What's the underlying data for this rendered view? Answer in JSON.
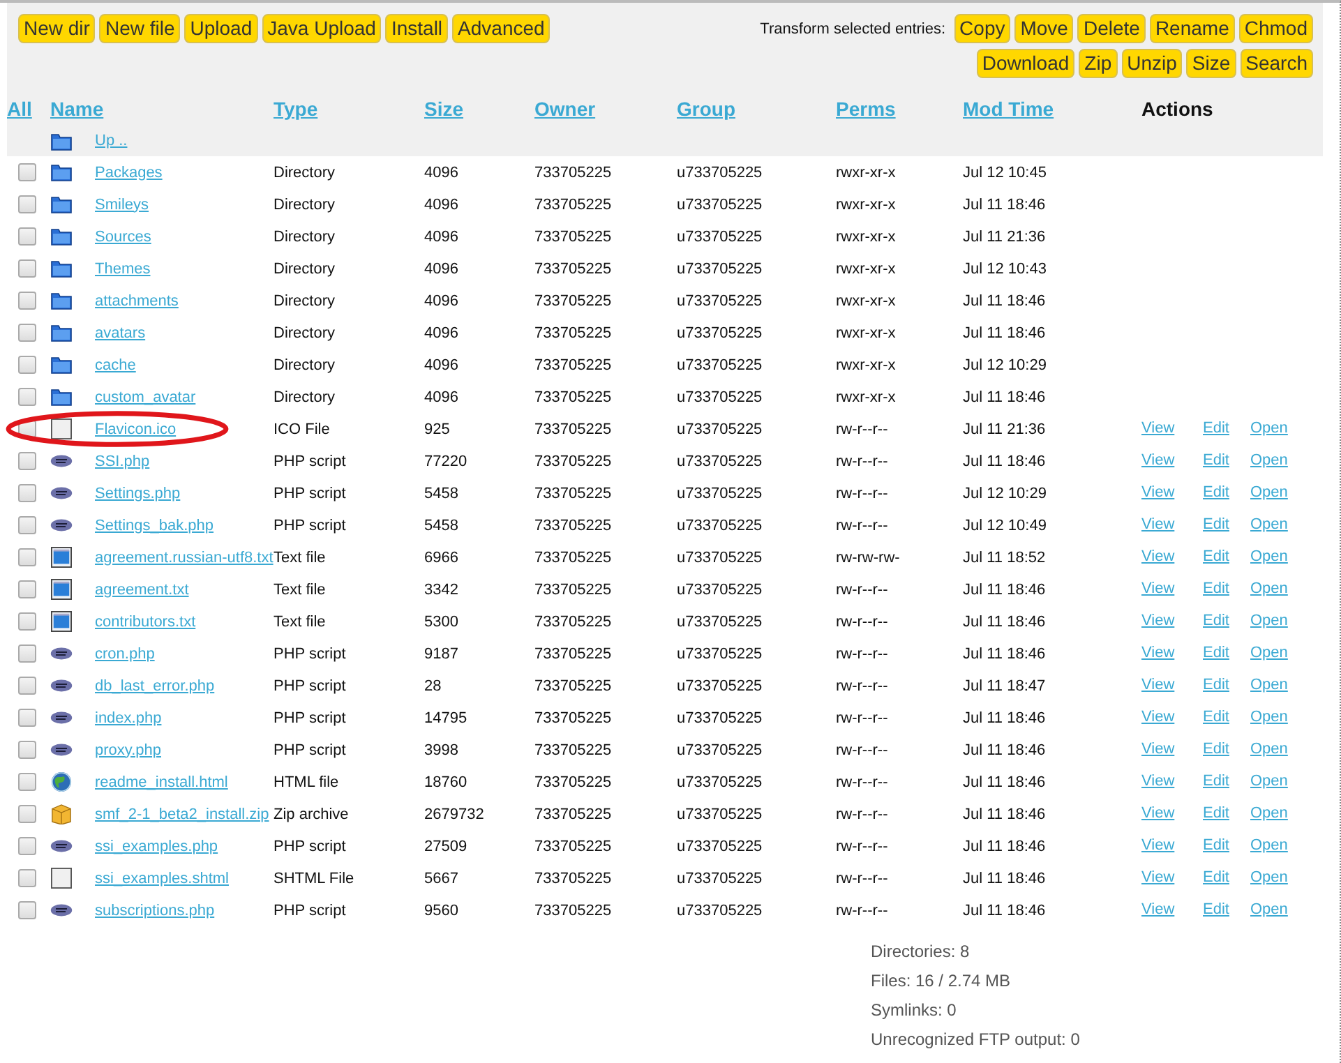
{
  "toolbar": {
    "buttons": [
      "New dir",
      "New file",
      "Upload",
      "Java Upload",
      "Install",
      "Advanced"
    ],
    "transform_label": "Transform selected entries:",
    "transform_buttons": [
      [
        "Copy",
        "Move",
        "Delete",
        "Rename",
        "Chmod"
      ],
      [
        "Download",
        "Zip",
        "Unzip",
        "Size",
        "Search"
      ]
    ]
  },
  "table": {
    "select_all": "All",
    "columns": [
      "Name",
      "Type",
      "Size",
      "Owner",
      "Group",
      "Perms",
      "Mod Time"
    ],
    "actions_heading": "Actions",
    "up": {
      "kind": "folder",
      "name": "Up .."
    },
    "rows": [
      {
        "kind": "folder",
        "checked": false,
        "circled": false,
        "name": "Packages",
        "type": "Directory",
        "size": "4096",
        "owner": "733705225",
        "group": "u733705225",
        "perms": "rwxr-xr-x",
        "time": "Jul 12 10:45",
        "actions": []
      },
      {
        "kind": "folder",
        "checked": false,
        "circled": false,
        "name": "Smileys",
        "type": "Directory",
        "size": "4096",
        "owner": "733705225",
        "group": "u733705225",
        "perms": "rwxr-xr-x",
        "time": "Jul 11 18:46",
        "actions": []
      },
      {
        "kind": "folder",
        "checked": false,
        "circled": false,
        "name": "Sources",
        "type": "Directory",
        "size": "4096",
        "owner": "733705225",
        "group": "u733705225",
        "perms": "rwxr-xr-x",
        "time": "Jul 11 21:36",
        "actions": []
      },
      {
        "kind": "folder",
        "checked": false,
        "circled": false,
        "name": "Themes",
        "type": "Directory",
        "size": "4096",
        "owner": "733705225",
        "group": "u733705225",
        "perms": "rwxr-xr-x",
        "time": "Jul 12 10:43",
        "actions": []
      },
      {
        "kind": "folder",
        "checked": false,
        "circled": false,
        "name": "attachments",
        "type": "Directory",
        "size": "4096",
        "owner": "733705225",
        "group": "u733705225",
        "perms": "rwxr-xr-x",
        "time": "Jul 11 18:46",
        "actions": []
      },
      {
        "kind": "folder",
        "checked": false,
        "circled": false,
        "name": "avatars",
        "type": "Directory",
        "size": "4096",
        "owner": "733705225",
        "group": "u733705225",
        "perms": "rwxr-xr-x",
        "time": "Jul 11 18:46",
        "actions": []
      },
      {
        "kind": "folder",
        "checked": false,
        "circled": false,
        "name": "cache",
        "type": "Directory",
        "size": "4096",
        "owner": "733705225",
        "group": "u733705225",
        "perms": "rwxr-xr-x",
        "time": "Jul 12 10:29",
        "actions": []
      },
      {
        "kind": "folder",
        "checked": false,
        "circled": false,
        "name": "custom_avatar",
        "type": "Directory",
        "size": "4096",
        "owner": "733705225",
        "group": "u733705225",
        "perms": "rwxr-xr-x",
        "time": "Jul 11 18:46",
        "actions": []
      },
      {
        "kind": "blank",
        "checked": false,
        "circled": true,
        "name": "Flavicon.ico",
        "type": "ICO File",
        "size": "925",
        "owner": "733705225",
        "group": "u733705225",
        "perms": "rw-r--r--",
        "time": "Jul 11 21:36",
        "actions": [
          "View",
          "Edit",
          "Open"
        ]
      },
      {
        "kind": "php",
        "checked": false,
        "circled": false,
        "name": "SSI.php",
        "type": "PHP script",
        "size": "77220",
        "owner": "733705225",
        "group": "u733705225",
        "perms": "rw-r--r--",
        "time": "Jul 11 18:46",
        "actions": [
          "View",
          "Edit",
          "Open"
        ]
      },
      {
        "kind": "php",
        "checked": false,
        "circled": false,
        "name": "Settings.php",
        "type": "PHP script",
        "size": "5458",
        "owner": "733705225",
        "group": "u733705225",
        "perms": "rw-r--r--",
        "time": "Jul 12 10:29",
        "actions": [
          "View",
          "Edit",
          "Open"
        ]
      },
      {
        "kind": "php",
        "checked": false,
        "circled": false,
        "name": "Settings_bak.php",
        "type": "PHP script",
        "size": "5458",
        "owner": "733705225",
        "group": "u733705225",
        "perms": "rw-r--r--",
        "time": "Jul 12 10:49",
        "actions": [
          "View",
          "Edit",
          "Open"
        ]
      },
      {
        "kind": "text",
        "checked": false,
        "circled": false,
        "name": "agreement.russian-utf8.txt",
        "type": "Text file",
        "size": "6966",
        "owner": "733705225",
        "group": "u733705225",
        "perms": "rw-rw-rw-",
        "time": "Jul 11 18:52",
        "actions": [
          "View",
          "Edit",
          "Open"
        ]
      },
      {
        "kind": "text",
        "checked": false,
        "circled": false,
        "name": "agreement.txt",
        "type": "Text file",
        "size": "3342",
        "owner": "733705225",
        "group": "u733705225",
        "perms": "rw-r--r--",
        "time": "Jul 11 18:46",
        "actions": [
          "View",
          "Edit",
          "Open"
        ]
      },
      {
        "kind": "text",
        "checked": false,
        "circled": false,
        "name": "contributors.txt",
        "type": "Text file",
        "size": "5300",
        "owner": "733705225",
        "group": "u733705225",
        "perms": "rw-r--r--",
        "time": "Jul 11 18:46",
        "actions": [
          "View",
          "Edit",
          "Open"
        ]
      },
      {
        "kind": "php",
        "checked": false,
        "circled": false,
        "name": "cron.php",
        "type": "PHP script",
        "size": "9187",
        "owner": "733705225",
        "group": "u733705225",
        "perms": "rw-r--r--",
        "time": "Jul 11 18:46",
        "actions": [
          "View",
          "Edit",
          "Open"
        ]
      },
      {
        "kind": "php",
        "checked": false,
        "circled": false,
        "name": "db_last_error.php",
        "type": "PHP script",
        "size": "28",
        "owner": "733705225",
        "group": "u733705225",
        "perms": "rw-r--r--",
        "time": "Jul 11 18:47",
        "actions": [
          "View",
          "Edit",
          "Open"
        ]
      },
      {
        "kind": "php",
        "checked": false,
        "circled": false,
        "name": "index.php",
        "type": "PHP script",
        "size": "14795",
        "owner": "733705225",
        "group": "u733705225",
        "perms": "rw-r--r--",
        "time": "Jul 11 18:46",
        "actions": [
          "View",
          "Edit",
          "Open"
        ]
      },
      {
        "kind": "php",
        "checked": false,
        "circled": false,
        "name": "proxy.php",
        "type": "PHP script",
        "size": "3998",
        "owner": "733705225",
        "group": "u733705225",
        "perms": "rw-r--r--",
        "time": "Jul 11 18:46",
        "actions": [
          "View",
          "Edit",
          "Open"
        ]
      },
      {
        "kind": "html",
        "checked": false,
        "circled": false,
        "name": "readme_install.html",
        "type": "HTML file",
        "size": "18760",
        "owner": "733705225",
        "group": "u733705225",
        "perms": "rw-r--r--",
        "time": "Jul 11 18:46",
        "actions": [
          "View",
          "Edit",
          "Open"
        ]
      },
      {
        "kind": "zip",
        "checked": false,
        "circled": false,
        "name": "smf_2-1_beta2_install.zip",
        "type": "Zip archive",
        "size": "2679732",
        "owner": "733705225",
        "group": "u733705225",
        "perms": "rw-r--r--",
        "time": "Jul 11 18:46",
        "actions": [
          "View",
          "Edit",
          "Open"
        ]
      },
      {
        "kind": "php",
        "checked": false,
        "circled": false,
        "name": "ssi_examples.php",
        "type": "PHP script",
        "size": "27509",
        "owner": "733705225",
        "group": "u733705225",
        "perms": "rw-r--r--",
        "time": "Jul 11 18:46",
        "actions": [
          "View",
          "Edit",
          "Open"
        ]
      },
      {
        "kind": "blank",
        "checked": false,
        "circled": false,
        "name": "ssi_examples.shtml",
        "type": "SHTML File",
        "size": "5667",
        "owner": "733705225",
        "group": "u733705225",
        "perms": "rw-r--r--",
        "time": "Jul 11 18:46",
        "actions": [
          "View",
          "Edit",
          "Open"
        ]
      },
      {
        "kind": "php",
        "checked": false,
        "circled": false,
        "name": "subscriptions.php",
        "type": "PHP script",
        "size": "9560",
        "owner": "733705225",
        "group": "u733705225",
        "perms": "rw-r--r--",
        "time": "Jul 11 18:46",
        "actions": [
          "View",
          "Edit",
          "Open"
        ]
      }
    ]
  },
  "summary": [
    "Directories: 8",
    "Files: 16 / 2.74 MB",
    "Symlinks: 0",
    "Unrecognized FTP output: 0"
  ]
}
